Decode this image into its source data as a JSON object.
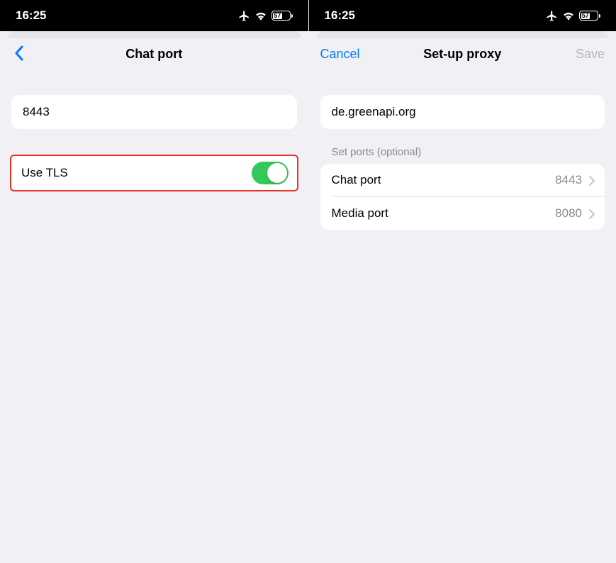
{
  "left": {
    "status_time": "16:25",
    "battery_pct": "57",
    "nav_title": "Chat port",
    "port_value": "8443",
    "tls_label": "Use TLS",
    "tls_on": true
  },
  "right": {
    "status_time": "16:25",
    "battery_pct": "57",
    "cancel": "Cancel",
    "title": "Set-up proxy",
    "save": "Save",
    "host_value": "de.greenapi.org",
    "section_ports": "Set ports (optional)",
    "rows": [
      {
        "label": "Chat port",
        "value": "8443"
      },
      {
        "label": "Media port",
        "value": "8080"
      }
    ]
  }
}
